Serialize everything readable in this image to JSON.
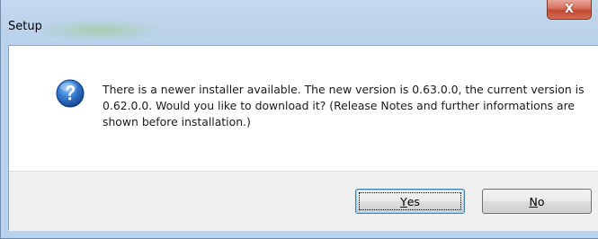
{
  "window": {
    "title": "Setup",
    "close_glyph": "X"
  },
  "message": {
    "icon": "question-icon",
    "text": "There is a newer installer available. The new version is 0.63.0.0, the current version is 0.62.0.0. Would you like to download it? (Release Notes and further informations are shown before installation.)"
  },
  "buttons": {
    "yes": {
      "mnemonic": "Y",
      "rest": "es",
      "default": true
    },
    "no": {
      "mnemonic": "N",
      "rest": "o",
      "default": false
    }
  },
  "colors": {
    "icon_blue": "#1f5fb4",
    "close_red": "#c34a34",
    "title_bar": "#bcd3ea"
  }
}
